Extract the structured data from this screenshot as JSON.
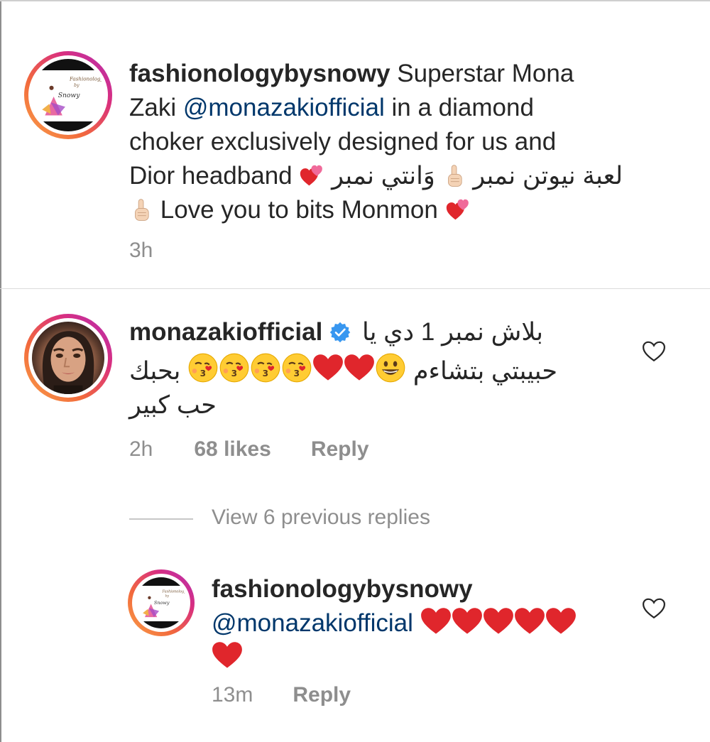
{
  "post": {
    "username": "fashionologybysnowy",
    "caption_lines": {
      "l1_text": "Superstar Mona",
      "l2_pre": "Zaki",
      "l2_mention": "@monazakiofficial",
      "l2_post": "in a diamond",
      "l3": "choker exclusively designed for us and",
      "l4_pre": "Dior headband",
      "l4_arabic_1": "وَانتي نمبر",
      "l4_arabic_2": "لعبة نيوتن نمبر",
      "l5": "Love you to bits Monmon"
    },
    "time": "3h"
  },
  "comment": {
    "username": "monazakiofficial",
    "line1_arabic": "بلاش نمبر 1 دي يا",
    "line2_arabic_left": "حبيبتي بتشاءم",
    "line2_arabic_right": "بحبك",
    "line3_arabic": "حب كبير",
    "time": "2h",
    "likes": "68 likes",
    "reply_label": "Reply"
  },
  "view_replies": "View 6 previous replies",
  "reply": {
    "username": "fashionologybysnowy",
    "mention": "@monazakiofficial",
    "time": "13m",
    "reply_label": "Reply"
  },
  "icons": {
    "like": "heart-outline-icon",
    "verified": "verified-badge-icon",
    "emojis": [
      "two-hearts-emoji",
      "index-pointing-up-emoji",
      "red-heart-emoji",
      "kissing-heart-emoji",
      "grinning-emoji"
    ]
  },
  "colors": {
    "mention": "#00376b",
    "muted": "#8e8e8e",
    "verified": "#3897f0",
    "heart": "#e0262c"
  }
}
